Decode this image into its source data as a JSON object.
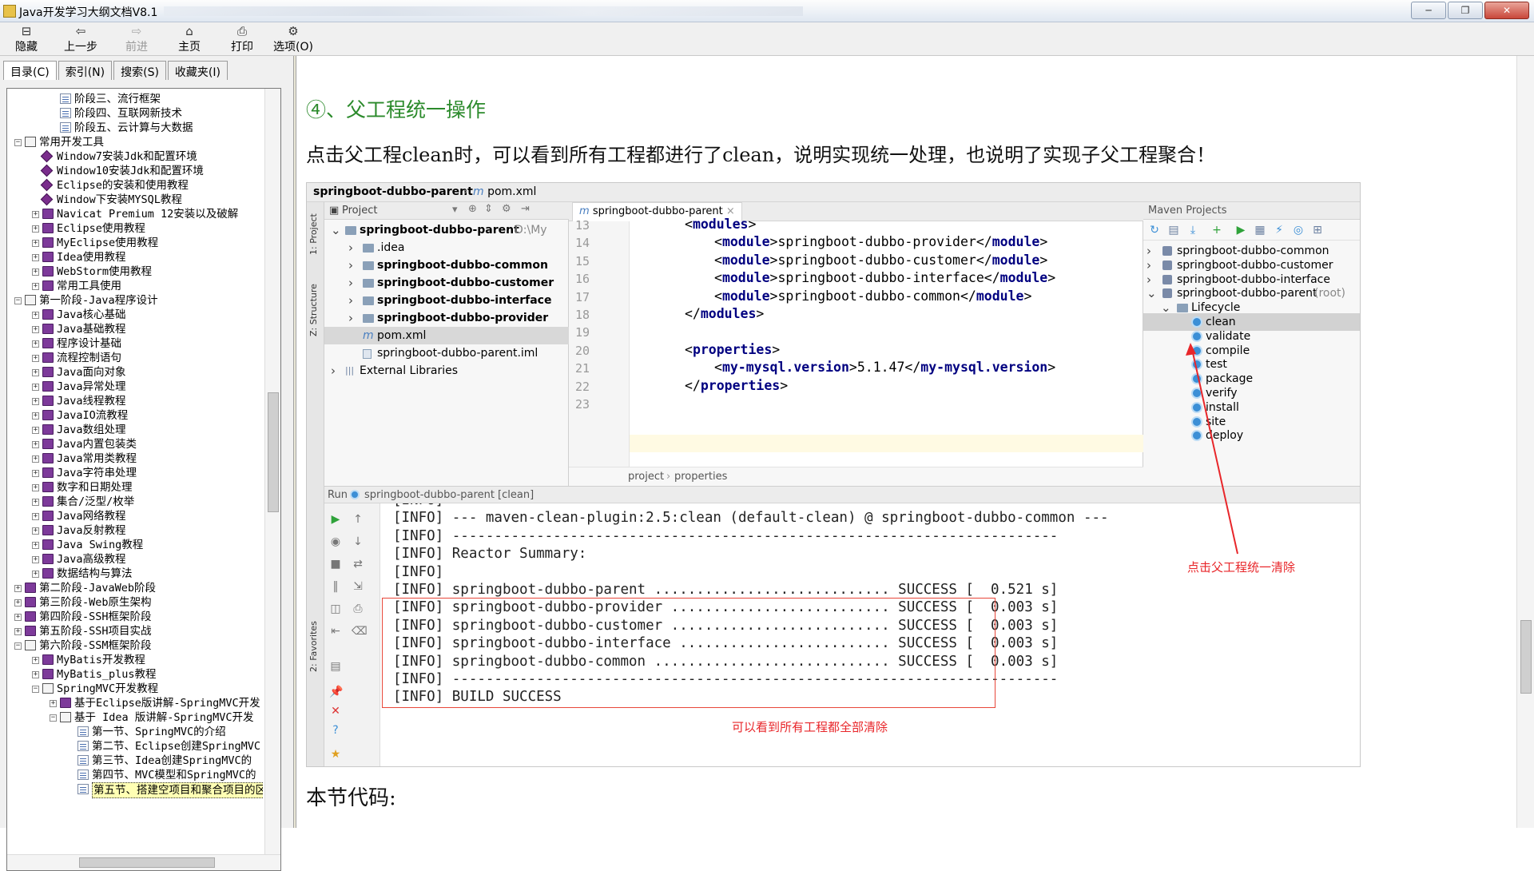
{
  "window": {
    "title": "Java开发学习大纲文档V8.1",
    "minimize": "─",
    "restore": "❐",
    "close": "✕"
  },
  "toolbar": [
    {
      "label": "隐藏",
      "icon": "hide-icon",
      "glyph": "⊟"
    },
    {
      "label": "上一步",
      "icon": "back-icon",
      "glyph": "⇦"
    },
    {
      "label": "前进",
      "icon": "forward-icon",
      "glyph": "⇨"
    },
    {
      "label": "主页",
      "icon": "home-icon",
      "glyph": "⌂"
    },
    {
      "label": "打印",
      "icon": "print-icon",
      "glyph": "⎙"
    },
    {
      "label": "选项(O)",
      "icon": "options-icon",
      "glyph": "⚙"
    }
  ],
  "nav_tabs": [
    "目录(C)",
    "索引(N)",
    "搜索(S)",
    "收藏夹(I)"
  ],
  "tree": [
    {
      "level": 2,
      "icon": "page",
      "label": "阶段三、流行框架"
    },
    {
      "level": 2,
      "icon": "page",
      "label": "阶段四、互联网新技术"
    },
    {
      "level": 2,
      "icon": "page",
      "label": "阶段五、云计算与大数据"
    },
    {
      "level": 0,
      "icon": "open",
      "toggle": "−",
      "label": "常用开发工具"
    },
    {
      "level": 1,
      "icon": "diamond",
      "label": "Window7安装Jdk和配置环境"
    },
    {
      "level": 1,
      "icon": "diamond",
      "label": "Window10安装Jdk和配置环境"
    },
    {
      "level": 1,
      "icon": "diamond",
      "label": "Eclipse的安装和使用教程"
    },
    {
      "level": 1,
      "icon": "diamond",
      "label": "Window下安装MYSQL教程"
    },
    {
      "level": 1,
      "icon": "book",
      "toggle": "+",
      "label": "Navicat Premium 12安装以及破解"
    },
    {
      "level": 1,
      "icon": "book",
      "toggle": "+",
      "label": "Eclipse使用教程"
    },
    {
      "level": 1,
      "icon": "book",
      "toggle": "+",
      "label": "MyEclipse使用教程"
    },
    {
      "level": 1,
      "icon": "book",
      "toggle": "+",
      "label": "Idea使用教程"
    },
    {
      "level": 1,
      "icon": "book",
      "toggle": "+",
      "label": "WebStorm使用教程"
    },
    {
      "level": 1,
      "icon": "book",
      "toggle": "+",
      "label": "常用工具使用"
    },
    {
      "level": 0,
      "icon": "open",
      "toggle": "−",
      "label": "第一阶段-Java程序设计"
    },
    {
      "level": 1,
      "icon": "book",
      "toggle": "+",
      "label": "Java核心基础"
    },
    {
      "level": 1,
      "icon": "book",
      "toggle": "+",
      "label": "Java基础教程"
    },
    {
      "level": 1,
      "icon": "book",
      "toggle": "+",
      "label": "程序设计基础"
    },
    {
      "level": 1,
      "icon": "book",
      "toggle": "+",
      "label": "流程控制语句"
    },
    {
      "level": 1,
      "icon": "book",
      "toggle": "+",
      "label": "Java面向对象"
    },
    {
      "level": 1,
      "icon": "book",
      "toggle": "+",
      "label": "Java异常处理"
    },
    {
      "level": 1,
      "icon": "book",
      "toggle": "+",
      "label": "Java线程教程"
    },
    {
      "level": 1,
      "icon": "book",
      "toggle": "+",
      "label": "JavaIO流教程"
    },
    {
      "level": 1,
      "icon": "book",
      "toggle": "+",
      "label": "Java数组处理"
    },
    {
      "level": 1,
      "icon": "book",
      "toggle": "+",
      "label": "Java内置包装类"
    },
    {
      "level": 1,
      "icon": "book",
      "toggle": "+",
      "label": "Java常用类教程"
    },
    {
      "level": 1,
      "icon": "book",
      "toggle": "+",
      "label": "Java字符串处理"
    },
    {
      "level": 1,
      "icon": "book",
      "toggle": "+",
      "label": "数字和日期处理"
    },
    {
      "level": 1,
      "icon": "book",
      "toggle": "+",
      "label": "集合/泛型/枚举"
    },
    {
      "level": 1,
      "icon": "book",
      "toggle": "+",
      "label": "Java网络教程"
    },
    {
      "level": 1,
      "icon": "book",
      "toggle": "+",
      "label": "Java反射教程"
    },
    {
      "level": 1,
      "icon": "book",
      "toggle": "+",
      "label": "Java Swing教程"
    },
    {
      "level": 1,
      "icon": "book",
      "toggle": "+",
      "label": "Java高级教程"
    },
    {
      "level": 1,
      "icon": "book",
      "toggle": "+",
      "label": "数据结构与算法"
    },
    {
      "level": 0,
      "icon": "book",
      "toggle": "+",
      "label": "第二阶段-JavaWeb阶段"
    },
    {
      "level": 0,
      "icon": "book",
      "toggle": "+",
      "label": "第三阶段-Web原生架构"
    },
    {
      "level": 0,
      "icon": "book",
      "toggle": "+",
      "label": "第四阶段-SSH框架阶段"
    },
    {
      "level": 0,
      "icon": "book",
      "toggle": "+",
      "label": "第五阶段-SSH项目实战"
    },
    {
      "level": 0,
      "icon": "open",
      "toggle": "−",
      "label": "第六阶段-SSM框架阶段"
    },
    {
      "level": 1,
      "icon": "book",
      "toggle": "+",
      "label": "MyBatis开发教程"
    },
    {
      "level": 1,
      "icon": "book",
      "toggle": "+",
      "label": "MyBatis_plus教程"
    },
    {
      "level": 1,
      "icon": "open",
      "toggle": "−",
      "label": "SpringMVC开发教程"
    },
    {
      "level": 2,
      "icon": "book",
      "toggle": "+",
      "label": "基于Eclipse版讲解-SpringMVC开发"
    },
    {
      "level": 2,
      "icon": "open",
      "toggle": "−",
      "label": "基于 Idea 版讲解-SpringMVC开发"
    },
    {
      "level": 3,
      "icon": "page",
      "label": "第一节、SpringMVC的介绍"
    },
    {
      "level": 3,
      "icon": "page",
      "label": "第二节、Eclipse创建SpringMVC"
    },
    {
      "level": 3,
      "icon": "page",
      "label": "第三节、Idea创建SpringMVC的"
    },
    {
      "level": 3,
      "icon": "page",
      "label": "第四节、MVC模型和SpringMVC的"
    },
    {
      "level": 3,
      "icon": "page",
      "label": "第五节、搭建空项目和聚合项目的区别",
      "selected": true
    }
  ],
  "doc": {
    "heading": "④、父工程统一操作",
    "paragraph": "点击父工程clean时，可以看到所有工程都进行了clean，说明实现统一处理，也说明了实现子父工程聚合！",
    "next_heading": "本节代码:"
  },
  "ide": {
    "crumbs": [
      "springboot-dubbo-parent",
      "pom.xml"
    ],
    "side_labels": [
      "1: Project",
      "Z: Structure",
      "2: Favorites"
    ],
    "project": {
      "header": "Project",
      "items": [
        {
          "indent": 0,
          "caret": "v",
          "label": "springboot-dubbo-parent",
          "suffix": "D:\\My",
          "bold": true
        },
        {
          "indent": 1,
          "caret": ">",
          "label": ".idea",
          "bold": false
        },
        {
          "indent": 1,
          "caret": ">",
          "label": "springboot-dubbo-common",
          "bold": true
        },
        {
          "indent": 1,
          "caret": ">",
          "label": "springboot-dubbo-customer",
          "bold": true
        },
        {
          "indent": 1,
          "caret": ">",
          "label": "springboot-dubbo-interface",
          "bold": true
        },
        {
          "indent": 1,
          "caret": ">",
          "label": "springboot-dubbo-provider",
          "bold": true
        },
        {
          "indent": 1,
          "caret": "",
          "label": "pom.xml",
          "bold": false,
          "selected": true
        },
        {
          "indent": 1,
          "caret": "",
          "label": "springboot-dubbo-parent.iml",
          "bold": false
        },
        {
          "indent": 0,
          "caret": ">",
          "label": "External Libraries",
          "bold": false
        }
      ]
    },
    "editor": {
      "tab": "springboot-dubbo-parent",
      "lines": [
        {
          "n": "13",
          "indent": 1,
          "parts": [
            {
              "t": "<"
            },
            {
              "tag": "modules"
            },
            {
              "t": ">"
            }
          ]
        },
        {
          "n": "14",
          "indent": 2,
          "parts": [
            {
              "t": "<"
            },
            {
              "tag": "module"
            },
            {
              "t": ">springboot-dubbo-provider</"
            },
            {
              "tag": "module"
            },
            {
              "t": ">"
            }
          ]
        },
        {
          "n": "15",
          "indent": 2,
          "parts": [
            {
              "t": "<"
            },
            {
              "tag": "module"
            },
            {
              "t": ">springboot-dubbo-customer</"
            },
            {
              "tag": "module"
            },
            {
              "t": ">"
            }
          ]
        },
        {
          "n": "16",
          "indent": 2,
          "parts": [
            {
              "t": "<"
            },
            {
              "tag": "module"
            },
            {
              "t": ">springboot-dubbo-interface</"
            },
            {
              "tag": "module"
            },
            {
              "t": ">"
            }
          ]
        },
        {
          "n": "17",
          "indent": 2,
          "parts": [
            {
              "t": "<"
            },
            {
              "tag": "module"
            },
            {
              "t": ">springboot-dubbo-common</"
            },
            {
              "tag": "module"
            },
            {
              "t": ">"
            }
          ]
        },
        {
          "n": "18",
          "indent": 1,
          "parts": [
            {
              "t": "</"
            },
            {
              "tag": "modules"
            },
            {
              "t": ">"
            }
          ]
        },
        {
          "n": "19",
          "indent": 0,
          "parts": []
        },
        {
          "n": "20",
          "indent": 1,
          "parts": [
            {
              "t": "<"
            },
            {
              "tag": "properties"
            },
            {
              "t": ">"
            }
          ]
        },
        {
          "n": "21",
          "indent": 2,
          "parts": [
            {
              "t": "<"
            },
            {
              "tag": "my-mysql.version"
            },
            {
              "t": ">5.1.47</"
            },
            {
              "tag": "my-mysql.version"
            },
            {
              "t": ">"
            }
          ]
        },
        {
          "n": "22",
          "indent": 1,
          "parts": [
            {
              "t": "</"
            },
            {
              "tag": "properties"
            },
            {
              "t": ">"
            }
          ]
        },
        {
          "n": "23",
          "indent": 0,
          "parts": []
        }
      ],
      "footer": [
        "project",
        "properties"
      ]
    },
    "maven": {
      "header": "Maven Projects",
      "items": [
        {
          "indent": 0,
          "caret": ">",
          "label": "springboot-dubbo-common",
          "icon": "maven"
        },
        {
          "indent": 0,
          "caret": ">",
          "label": "springboot-dubbo-customer",
          "icon": "maven"
        },
        {
          "indent": 0,
          "caret": ">",
          "label": "springboot-dubbo-interface",
          "icon": "maven"
        },
        {
          "indent": 0,
          "caret": "v",
          "label": "springboot-dubbo-parent",
          "suffix": "(root)",
          "icon": "maven"
        },
        {
          "indent": 1,
          "caret": "v",
          "label": "Lifecycle",
          "icon": "folder"
        },
        {
          "indent": 2,
          "caret": "",
          "label": "clean",
          "icon": "gear",
          "selected": true
        },
        {
          "indent": 2,
          "caret": "",
          "label": "validate",
          "icon": "gear"
        },
        {
          "indent": 2,
          "caret": "",
          "label": "compile",
          "icon": "gear"
        },
        {
          "indent": 2,
          "caret": "",
          "label": "test",
          "icon": "gear"
        },
        {
          "indent": 2,
          "caret": "",
          "label": "package",
          "icon": "gear"
        },
        {
          "indent": 2,
          "caret": "",
          "label": "verify",
          "icon": "gear"
        },
        {
          "indent": 2,
          "caret": "",
          "label": "install",
          "icon": "gear"
        },
        {
          "indent": 2,
          "caret": "",
          "label": "site",
          "icon": "gear"
        },
        {
          "indent": 2,
          "caret": "",
          "label": "deploy",
          "icon": "gear"
        }
      ]
    },
    "run": {
      "label": "Run",
      "config": "springboot-dubbo-parent [clean]",
      "lines": [
        "[INFO]",
        "[INFO] --- maven-clean-plugin:2.5:clean (default-clean) @ springboot-dubbo-common ---",
        "[INFO] ------------------------------------------------------------------------",
        "[INFO] Reactor Summary:",
        "[INFO]",
        "[INFO] springboot-dubbo-parent ............................ SUCCESS [  0.521 s]",
        "[INFO] springboot-dubbo-provider .......................... SUCCESS [  0.003 s]",
        "[INFO] springboot-dubbo-customer .......................... SUCCESS [  0.003 s]",
        "[INFO] springboot-dubbo-interface ......................... SUCCESS [  0.003 s]",
        "[INFO] springboot-dubbo-common ............................ SUCCESS [  0.003 s]",
        "[INFO] ------------------------------------------------------------------------",
        "[INFO] BUILD SUCCESS"
      ]
    }
  },
  "annotations": {
    "maven_note": "点击父工程统一清除",
    "console_note": "可以看到所有工程都全部清除",
    "color": "#e8262a"
  }
}
